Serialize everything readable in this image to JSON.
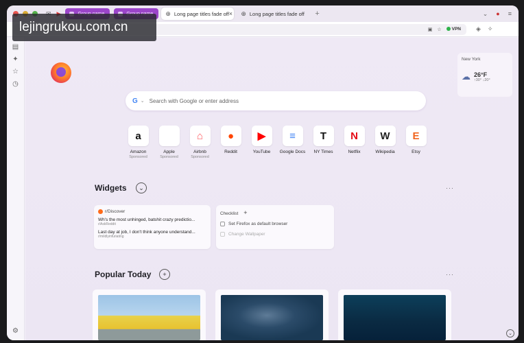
{
  "watermark": "lejingrukou.com.cn",
  "tabs": {
    "group_tabs": [
      "Group name",
      "Group name"
    ],
    "tabs": [
      {
        "label": "Long page titles fade off",
        "active": true
      },
      {
        "label": "Long page titles fade off",
        "active": false
      }
    ]
  },
  "navbar": {
    "url_text": "ge",
    "vpn_label": "VPN"
  },
  "weather": {
    "city": "New York",
    "temp": "26°F",
    "hilo": "↑30° ↓20°"
  },
  "search": {
    "placeholder": "Search with Google or enter address"
  },
  "shortcuts": [
    {
      "name": "Amazon",
      "sub": "Sponsored",
      "glyph": "a",
      "color": "#111111"
    },
    {
      "name": "Apple",
      "sub": "Sponsored",
      "glyph": "",
      "color": "#111111"
    },
    {
      "name": "Airbnb",
      "sub": "Sponsored",
      "glyph": "⌂",
      "color": "#ff5a5f"
    },
    {
      "name": "Reddit",
      "sub": "",
      "glyph": "●",
      "color": "#ff4500"
    },
    {
      "name": "YouTube",
      "sub": "",
      "glyph": "▶",
      "color": "#ff0000"
    },
    {
      "name": "Google Docs",
      "sub": "",
      "glyph": "≡",
      "color": "#4285f4"
    },
    {
      "name": "NY Times",
      "sub": "",
      "glyph": "T",
      "color": "#111111"
    },
    {
      "name": "Netflix",
      "sub": "",
      "glyph": "N",
      "color": "#e50914"
    },
    {
      "name": "Wikipedia",
      "sub": "",
      "glyph": "W",
      "color": "#222222"
    },
    {
      "name": "Etsy",
      "sub": "",
      "glyph": "E",
      "color": "#f1641e"
    }
  ],
  "widgets": {
    "title": "Widgets",
    "discover": {
      "header": "r/Discover",
      "posts": [
        {
          "title": "Wh's the most unhinged, batshit crazy predictio...",
          "sub": "r/AskReddit"
        },
        {
          "title": "Last day at job, I don't think anyone understand...",
          "sub": "r/mildlyinfuriating"
        }
      ]
    },
    "checklist": {
      "header": "Checklist",
      "items": [
        {
          "label": "Set Firefox as default browser",
          "faded": false
        },
        {
          "label": "Change Wallpaper",
          "faded": true
        }
      ]
    }
  },
  "popular": {
    "title": "Popular Today"
  }
}
